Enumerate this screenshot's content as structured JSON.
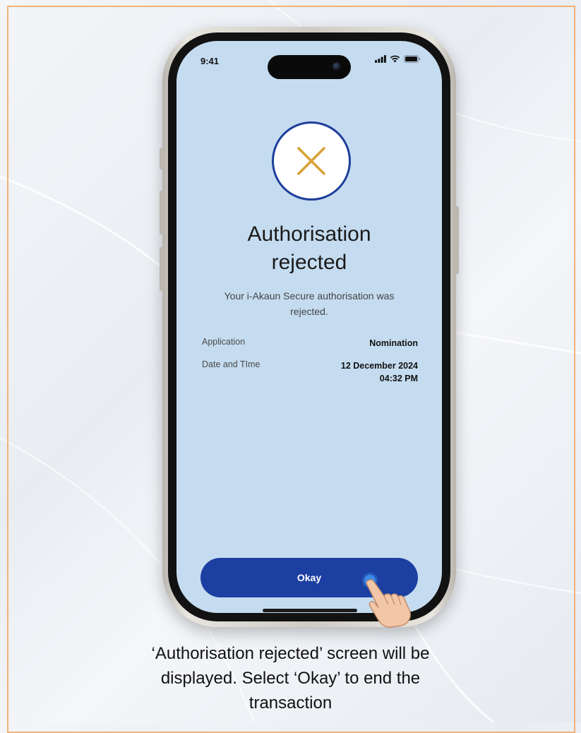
{
  "status_bar": {
    "time": "9:41"
  },
  "result": {
    "icon": "x-icon",
    "title_line1": "Authorisation",
    "title_line2": "rejected",
    "message_line1": "Your i-Akaun Secure authorisation was",
    "message_line2": "rejected."
  },
  "details": [
    {
      "label": "Application",
      "value_line1": "Nomination",
      "value_line2": ""
    },
    {
      "label": "Date and TIme",
      "value_line1": "12 December 2024",
      "value_line2": "04:32 PM"
    }
  ],
  "okay_button": {
    "label": "Okay"
  },
  "caption": {
    "line1": "‘Authorisation rejected’ screen will be",
    "line2": "displayed. Select ‘Okay’ to end the",
    "line3": "transaction"
  },
  "colors": {
    "screen_bg": "#c5dcf0",
    "primary_blue": "#1c3fa2",
    "icon_gold": "#d9a23b",
    "frame_orange": "#f0b27a"
  }
}
